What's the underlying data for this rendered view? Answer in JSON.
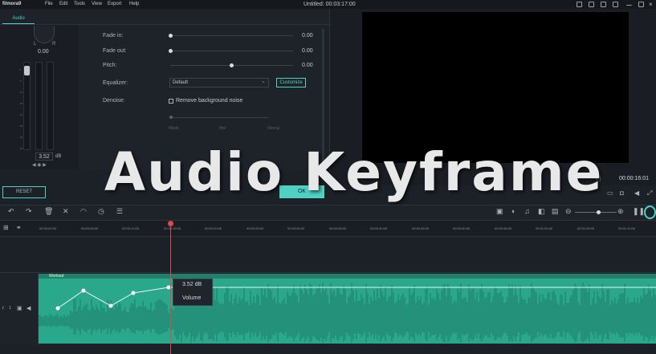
{
  "menubar": {
    "logo": "filmora9",
    "items": [
      "File",
      "Edit",
      "Tools",
      "View",
      "Export",
      "Help"
    ],
    "title": "Untitled:  00:03:17:00"
  },
  "tabs": {
    "audio": "Audio"
  },
  "meter": {
    "left": "L",
    "right": "R",
    "value": "0.00",
    "db": "3.52",
    "db_unit": "dB",
    "scale": [
      "0",
      "-6",
      "-12",
      "-18",
      "-24",
      "-30",
      "-36",
      "-42",
      "-48",
      "-54"
    ]
  },
  "form": {
    "fade_in": {
      "label": "Fade in:",
      "value": "0.00"
    },
    "fade_out": {
      "label": "Fade out:",
      "value": "0.00"
    },
    "pitch": {
      "label": "Pitch:",
      "value": "0.00"
    },
    "equalizer": {
      "label": "Equalizer:",
      "value": "Default",
      "button": "Customize"
    },
    "denoise": {
      "label": "Denoise:",
      "checkbox": "Remove background noise",
      "levels": [
        "Weak",
        "Mid",
        "Strong"
      ]
    }
  },
  "buttons": {
    "reset": "RESET",
    "ok": "OK"
  },
  "preview": {
    "timecode": "00:00:16:01"
  },
  "ruler": [
    "00:00:00:00",
    "00:00:05:00",
    "00:00:10:00",
    "00:00:15:00",
    "00:00:20:00",
    "00:00:25:00",
    "00:00:30:00",
    "00:00:35:00",
    "00:00:40:00",
    "00:00:45:00",
    "00:00:50:00",
    "00:00:55:00",
    "00:01:00:00",
    "00:01:05:00",
    "00:01:10:00"
  ],
  "track": {
    "clip_name": "Workout",
    "number": "1"
  },
  "keyframe_tip": {
    "value": "3.52 dB",
    "label": "Volume"
  },
  "overlay": {
    "title": "Audio Keyframe"
  },
  "colors": {
    "accent": "#4fd1c5",
    "clip": "#2aa88c",
    "playhead": "#e04848"
  }
}
